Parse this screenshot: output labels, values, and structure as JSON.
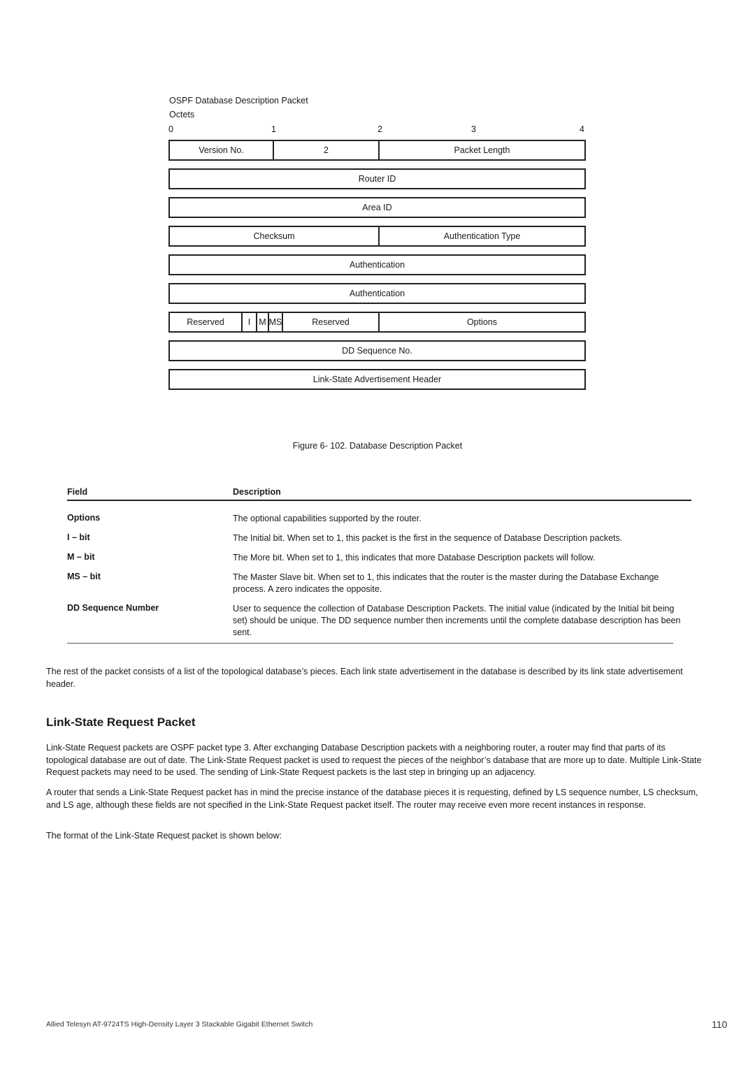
{
  "diagram": {
    "title": "OSPF Database Description Packet",
    "octets_label": "Octets",
    "ticks": [
      "0",
      "1",
      "2",
      "3",
      "4"
    ],
    "rows": [
      [
        "Version No.",
        "2",
        "Packet Length"
      ],
      [
        "Router ID"
      ],
      [
        "Area ID"
      ],
      [
        "Checksum",
        "Authentication Type"
      ],
      [
        "Authentication"
      ],
      [
        "Authentication"
      ],
      [
        "Reserved",
        "I",
        "M",
        "MS",
        "Reserved",
        "Options"
      ],
      [
        "DD Sequence No."
      ],
      [
        "Link-State Advertisement Header"
      ]
    ],
    "caption": "Figure 6- 102. Database Description Packet"
  },
  "table": {
    "headers": [
      "Field",
      "Description"
    ],
    "rows": [
      {
        "field": "Options",
        "description": "The optional capabilities supported by the router."
      },
      {
        "field": "I – bit",
        "description": "The Initial bit. When set to 1, this packet is the first in the sequence of Database Description packets."
      },
      {
        "field": "M – bit",
        "description": "The More bit. When set to 1, this indicates that more Database Description packets will follow."
      },
      {
        "field": "MS – bit",
        "description": "The Master Slave bit. When set to 1, this indicates that the router is the master during the Database Exchange process. A zero indicates the opposite."
      },
      {
        "field": "DD Sequence Number",
        "description": "User to sequence the collection of Database Description Packets. The initial value (indicated by the Initial bit being set) should be unique. The DD sequence number then increments until the complete database description has been sent."
      }
    ]
  },
  "body": {
    "para1": "The rest of the packet consists of a list of the topological database’s pieces. Each link state advertisement in the database is described by its link state advertisement header.",
    "heading": "Link-State Request Packet",
    "para2": "Link-State Request packets are OSPF packet type 3. After exchanging Database Description packets with a neighboring router, a router may find that parts of its topological database are out of date. The Link-State Request packet is used to request the pieces of the neighbor’s database that are more up to date. Multiple Link-State Request packets may need to be used. The sending of Link-State Request packets is the last step in bringing up an adjacency.",
    "para3": "A router that sends a Link-State Request packet has in mind the precise instance of the database pieces it is requesting, defined by LS sequence number, LS checksum, and LS age, although these fields are not specified in the Link-State Request packet itself. The router may receive even more recent instances in response.",
    "para4": "The format of the Link-State Request packet is shown below:"
  },
  "footer": {
    "text": "Allied Telesyn AT-9724TS High-Density Layer 3 Stackable Gigabit Ethernet Switch",
    "page_number": "110"
  }
}
